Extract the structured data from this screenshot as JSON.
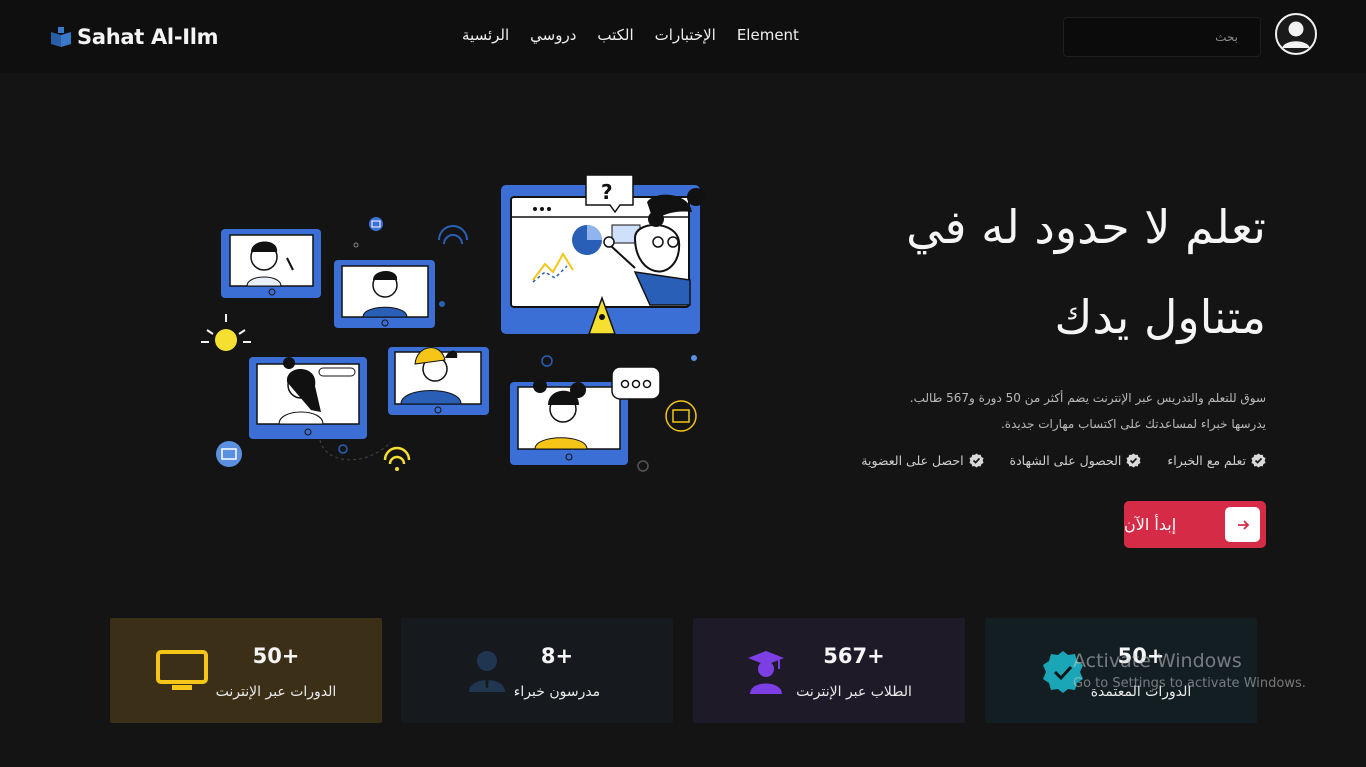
{
  "header": {
    "logo_text": "Sahat Al-Ilm",
    "nav": [
      {
        "label": "الرئسية"
      },
      {
        "label": "دروسي"
      },
      {
        "label": "الكتب"
      },
      {
        "label": "الإختبارات"
      },
      {
        "label": "Element"
      }
    ],
    "search_placeholder": "بحث"
  },
  "hero": {
    "title_line1": "تعلم لا حدود له في",
    "title_line2": "متناول يدك",
    "desc_line1": "سوق للتعلم والتدريس عبر الإنترنت يضم أكثر من 50 دورة و567 طالب.",
    "desc_line2": "يدرسها خبراء لمساعدتك على اكتساب مهارات جديدة.",
    "features": [
      "تعلم مع الخبراء",
      "الحصول على الشهادة",
      "احصل على العضوية"
    ],
    "cta_label": "إبدأ الآن"
  },
  "stats": [
    {
      "value": "50+",
      "label": "الدورات عبر الإنترنت",
      "icon": "monitor-icon",
      "color": "#f5c518"
    },
    {
      "value": "8+",
      "label": "مدرسون خبراء",
      "icon": "instructor-icon",
      "color": "#1f3550"
    },
    {
      "value": "567+",
      "label": "الطلاب عبر الإنترنت",
      "icon": "graduate-icon",
      "color": "#7b3fe4"
    },
    {
      "value": "50+",
      "label": "الدورات المعتمدة",
      "icon": "certified-badge-icon",
      "color": "#1aa6b7"
    }
  ],
  "watermark": {
    "title": "Activate Windows",
    "subtitle": "Go to Settings to activate Windows."
  },
  "colors": {
    "background": "#141414",
    "accent": "#d62b47",
    "header": "#0f0f0f"
  }
}
